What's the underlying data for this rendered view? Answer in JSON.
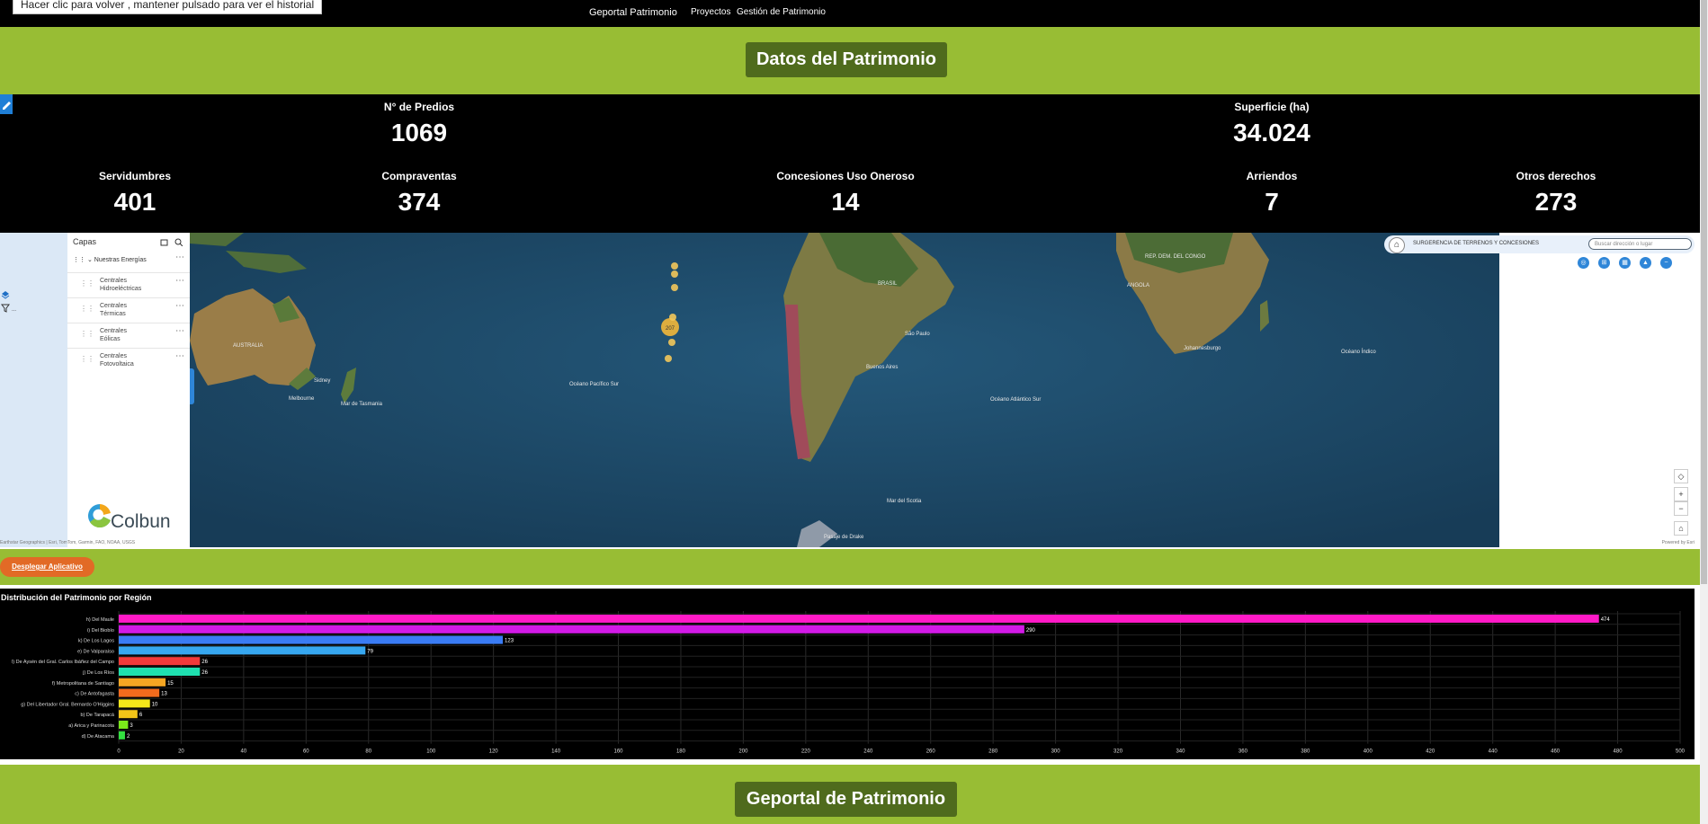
{
  "tooltip": "Hacer clic para volver , mantener pulsado para ver el historial",
  "nav": {
    "brand": "Geportal Patrimonio",
    "items": [
      "Proyectos",
      "Gestión de Patrimonio"
    ]
  },
  "hero": {
    "title": "Datos del Patrimonio"
  },
  "stats": {
    "predios": {
      "label": "N° de Predios",
      "value": "1069"
    },
    "superficie": {
      "label": "Superficie (ha)",
      "value": "34.024"
    },
    "servidumbres": {
      "label": "Servidumbres",
      "value": "401"
    },
    "compraventas": {
      "label": "Compraventas",
      "value": "374"
    },
    "concesiones": {
      "label": "Concesiones Uso Oneroso",
      "value": "14"
    },
    "arriendos": {
      "label": "Arriendos",
      "value": "7"
    },
    "otros": {
      "label": "Otros derechos",
      "value": "273"
    }
  },
  "layers": {
    "title": "Capas",
    "group": "Nuestras Energías",
    "items": [
      [
        "Centrales",
        "Hidroeléctricas"
      ],
      [
        "Centrales",
        "Térmicas"
      ],
      [
        "Centrales",
        "Eólicas"
      ],
      [
        "Centrales",
        "Fotovoltaica"
      ]
    ]
  },
  "logo": {
    "text": "Colbun"
  },
  "map": {
    "attribution": "Earthstar Geographics | Esri, TomTom, Garmin, FAO, NOAA, USGS",
    "powered": "Powered by Esri",
    "survey_label": "SURGERENCIA DE TERRENOS Y CONCESIONES",
    "search_placeholder": "Buscar dirección o lugar",
    "labels": {
      "australia": "AUSTRALIA",
      "sydney": "Sidney",
      "melbourne": "Melbourne",
      "tasman": "Mar de Tasmania",
      "pacific": "Océano Pacífico Sur",
      "brasil": "BRASIL",
      "saopaulo": "São Paulo",
      "buenosaires": "Buenos Aires",
      "atlantic": "Océano Atlántico Sur",
      "indian": "Océano Índico",
      "johannesburg": "Johannesburgo",
      "angola": "ANGOLA",
      "congo": "REP. DEM. DEL CONGO",
      "drake": "Pasaje de Drake",
      "scotia": "Mar del Scotia",
      "cluster": "207"
    },
    "colors": {
      "ocean": "#1d4a68",
      "land": "#8a7a4a",
      "forest": "#4f6d3a"
    }
  },
  "deploy": {
    "label": "Desplegar Aplicativo"
  },
  "chart_data": {
    "type": "bar",
    "orientation": "horizontal",
    "title": "Distribución del Patrimonio por Región",
    "categories": [
      "h) Del Maule",
      "i) Del Biobío",
      "k) De Los Lagos",
      "e) De Valparaíso",
      "l) De Aysén del Gral. Carlos Ibáñez del Campo",
      "j) De Los Ríos",
      "f) Metropolitana de Santiago",
      "c) De Antofagasta",
      "g) Del Libertador Gral. Bernardo O'Higgins",
      "b) De Tarapacá",
      "a) Arica y Parinacota",
      "d) De Atacama"
    ],
    "values": [
      474,
      290,
      123,
      79,
      26,
      26,
      15,
      13,
      10,
      6,
      3,
      2
    ],
    "colors": [
      "#ff1ac6",
      "#d21ae6",
      "#3a7cf5",
      "#36a7f0",
      "#f23a3a",
      "#1fe0b0",
      "#f5a623",
      "#f26b1d",
      "#f5e81a",
      "#f2c418",
      "#7ae81a",
      "#33e040"
    ],
    "xlim": [
      0,
      500
    ],
    "xticks": [
      0,
      20,
      40,
      60,
      80,
      100,
      120,
      140,
      160,
      180,
      200,
      220,
      240,
      260,
      280,
      300,
      320,
      340,
      360,
      380,
      400,
      420,
      440,
      460,
      480,
      500
    ],
    "grid": true
  },
  "footer": {
    "title": "Geportal de Patrimonio"
  }
}
